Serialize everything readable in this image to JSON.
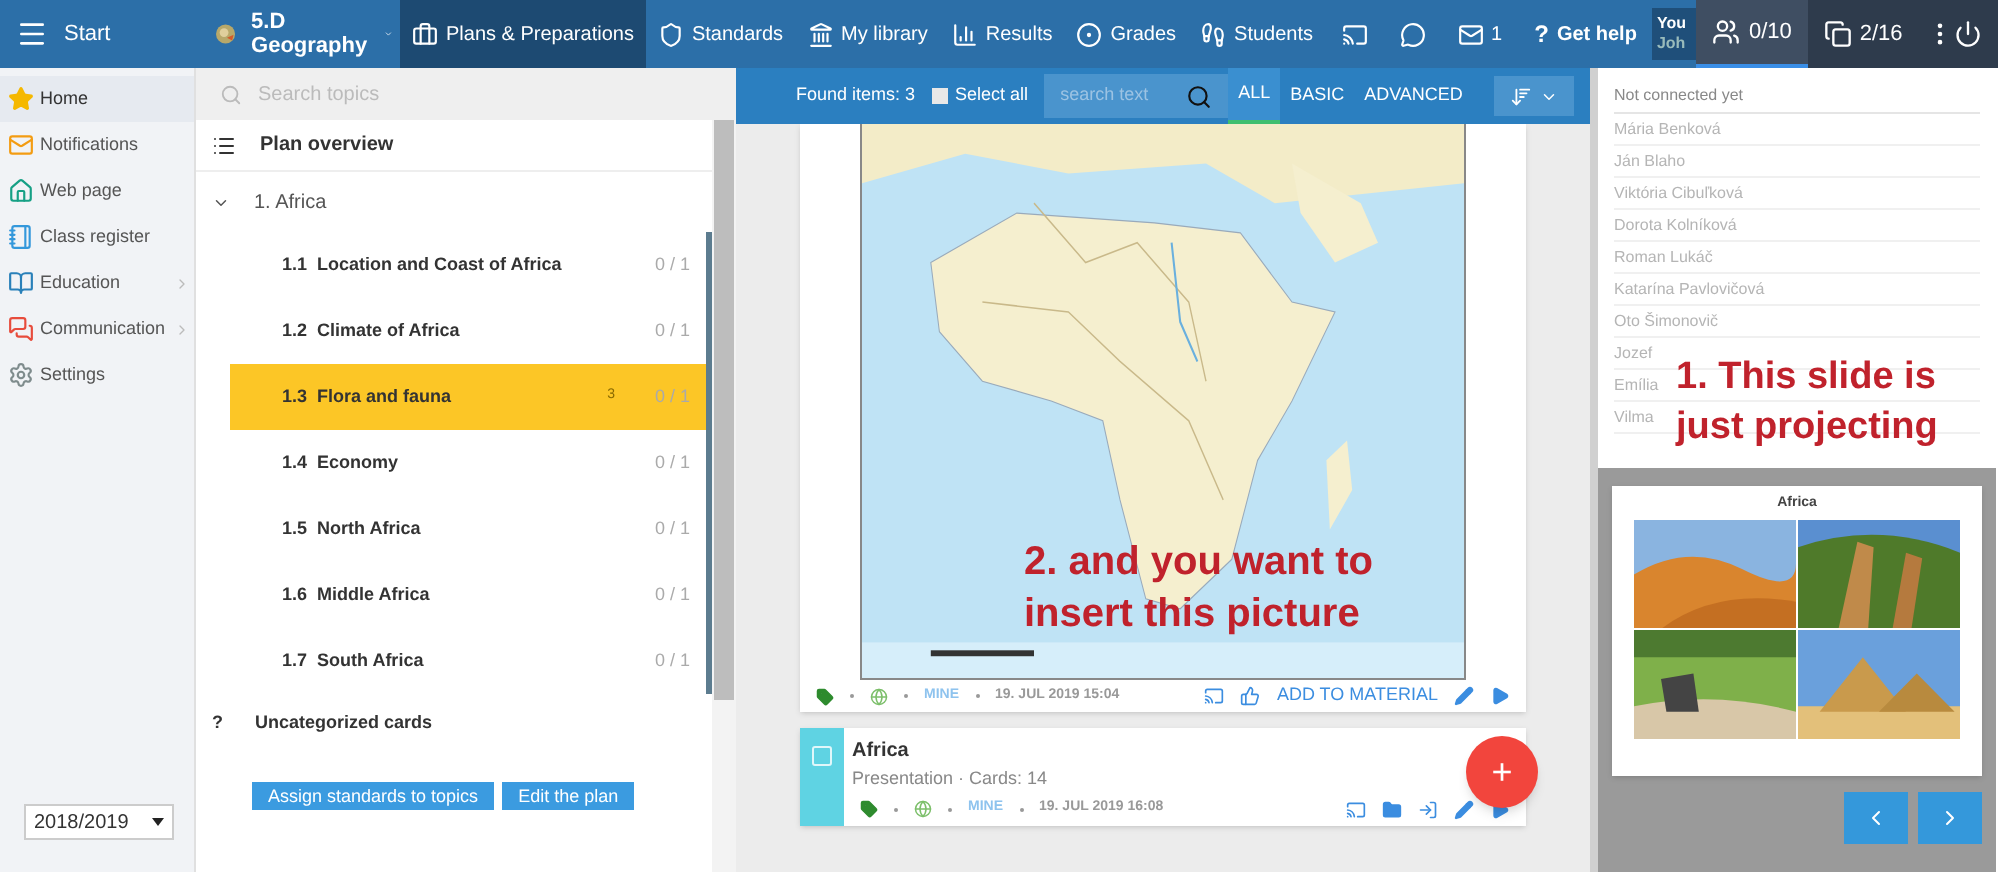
{
  "top_bar": {
    "menu": "Start",
    "class_name": "5.D",
    "subject": "Geography",
    "nav": [
      {
        "label": "Plans & Preparations",
        "selected": true
      },
      {
        "label": "Standards",
        "selected": false
      },
      {
        "label": "My library",
        "selected": false
      },
      {
        "label": "Results",
        "selected": false
      },
      {
        "label": "Grades",
        "selected": false
      },
      {
        "label": "Students",
        "selected": false
      }
    ],
    "messages_count": "1",
    "help_mark": "?",
    "help": "Get help",
    "user_line1": "You",
    "user_line2": "Joh"
  },
  "right_tabs": [
    {
      "label": "0/10",
      "selected": true
    },
    {
      "label": "2/16",
      "selected": false
    }
  ],
  "sidebar": {
    "items": [
      {
        "label": "Home",
        "submenu": false,
        "selected": true
      },
      {
        "label": "Notifications",
        "submenu": false,
        "selected": false
      },
      {
        "label": "Web page",
        "submenu": false,
        "selected": false
      },
      {
        "label": "Class register",
        "submenu": false,
        "selected": false
      },
      {
        "label": "Education",
        "submenu": true,
        "selected": false
      },
      {
        "label": "Communication",
        "submenu": true,
        "selected": false
      },
      {
        "label": "Settings",
        "submenu": false,
        "selected": false
      }
    ],
    "year": "2018/2019"
  },
  "plan": {
    "search_placeholder": "Search topics",
    "title": "Plan overview",
    "topic": {
      "label": "1. Africa",
      "expanded": true,
      "children": [
        {
          "number": "1.1",
          "title": "Location and Coast of Africa",
          "progress": "0 / 1",
          "selected": false
        },
        {
          "number": "1.2",
          "title": "Climate of Africa",
          "progress": "0 / 1",
          "selected": false
        },
        {
          "number": "1.3",
          "title": "Flora and fauna",
          "count": "3",
          "progress": "0 / 1",
          "selected": true
        },
        {
          "number": "1.4",
          "title": "Economy",
          "progress": "0 / 1",
          "selected": false
        },
        {
          "number": "1.5",
          "title": "North Africa",
          "progress": "0 / 1",
          "selected": false
        },
        {
          "number": "1.6",
          "title": "Middle Africa",
          "progress": "0 / 1",
          "selected": false
        },
        {
          "number": "1.7",
          "title": "South Africa",
          "progress": "0 / 1",
          "selected": false
        }
      ]
    },
    "uncategorized_mark": "?",
    "uncategorized": "Uncategorized cards",
    "buttons": [
      "Assign standards to topics",
      "Edit the plan"
    ]
  },
  "materials": {
    "found": "Found items: 3",
    "select_all": {
      "label": "Select all",
      "checked": false
    },
    "search_placeholder": "search text",
    "filters": [
      {
        "label": "ALL",
        "selected": true
      },
      {
        "label": "BASIC",
        "selected": false
      },
      {
        "label": "ADVANCED",
        "selected": false
      }
    ],
    "cards": [
      {
        "kind": "map",
        "tag": "MINE",
        "date": "19. JUL 2019 15:04",
        "action": "ADD TO MATERIAL"
      },
      {
        "kind": "presentation",
        "title": "Africa",
        "subtitle": "Presentation · Cards: 14",
        "tag": "MINE",
        "date": "19. JUL 2019 16:08"
      }
    ],
    "add_label": "+"
  },
  "students": {
    "heading": "Not connected yet",
    "names": [
      "Mária Benková",
      "Ján Blaho",
      "Viktória Cibuľková",
      "Dorota Kolníková",
      "Roman Lukáč",
      "Katarína Pavlovičová",
      "Oto Šimonovič",
      "Jozef",
      "Emília",
      "Vilma"
    ]
  },
  "slide": {
    "title": "Africa"
  },
  "annotations": [
    "1. This slide is just projecting",
    "2. and you want to insert this picture"
  ]
}
